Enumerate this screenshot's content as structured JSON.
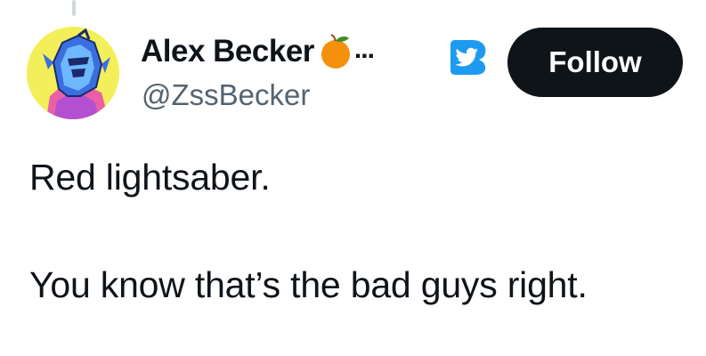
{
  "author": {
    "display_name": "Alex Becker",
    "emoji_icon": "tangerine-emoji",
    "truncation": "...",
    "handle": "@ZssBecker",
    "avatar_icon": "armored-robot-avatar"
  },
  "badge_icon": "bird-badge-icon",
  "follow_button": {
    "label": "Follow"
  },
  "tweet": {
    "lines": [
      "Red lightsaber.",
      "You know that’s the bad guys right."
    ]
  },
  "colors": {
    "text_primary": "#0f1419",
    "text_secondary": "#536471",
    "follow_bg": "#0f1419",
    "badge_blue": "#1d9bf0",
    "avatar_bg": "#f3ef5a"
  }
}
